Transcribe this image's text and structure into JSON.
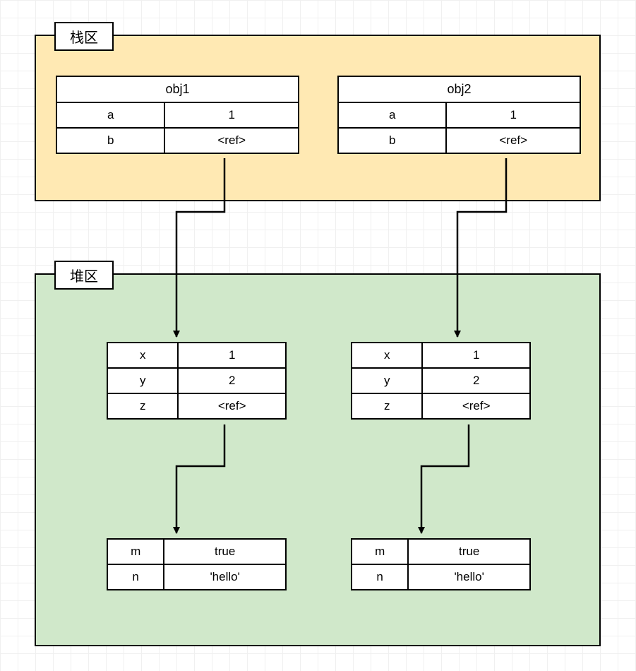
{
  "stack": {
    "label": "栈区",
    "obj1": {
      "name": "obj1",
      "rows": [
        {
          "k": "a",
          "v": "1"
        },
        {
          "k": "b",
          "v": "<ref>"
        }
      ]
    },
    "obj2": {
      "name": "obj2",
      "rows": [
        {
          "k": "a",
          "v": "1"
        },
        {
          "k": "b",
          "v": "<ref>"
        }
      ]
    }
  },
  "heap": {
    "label": "堆区",
    "left_upper": {
      "rows": [
        {
          "k": "x",
          "v": "1"
        },
        {
          "k": "y",
          "v": "2"
        },
        {
          "k": "z",
          "v": "<ref>"
        }
      ]
    },
    "right_upper": {
      "rows": [
        {
          "k": "x",
          "v": "1"
        },
        {
          "k": "y",
          "v": "2"
        },
        {
          "k": "z",
          "v": "<ref>"
        }
      ]
    },
    "left_lower": {
      "rows": [
        {
          "k": "m",
          "v": "true"
        },
        {
          "k": "n",
          "v": "'hello'"
        }
      ]
    },
    "right_lower": {
      "rows": [
        {
          "k": "m",
          "v": "true"
        },
        {
          "k": "n",
          "v": "'hello'"
        }
      ]
    }
  }
}
